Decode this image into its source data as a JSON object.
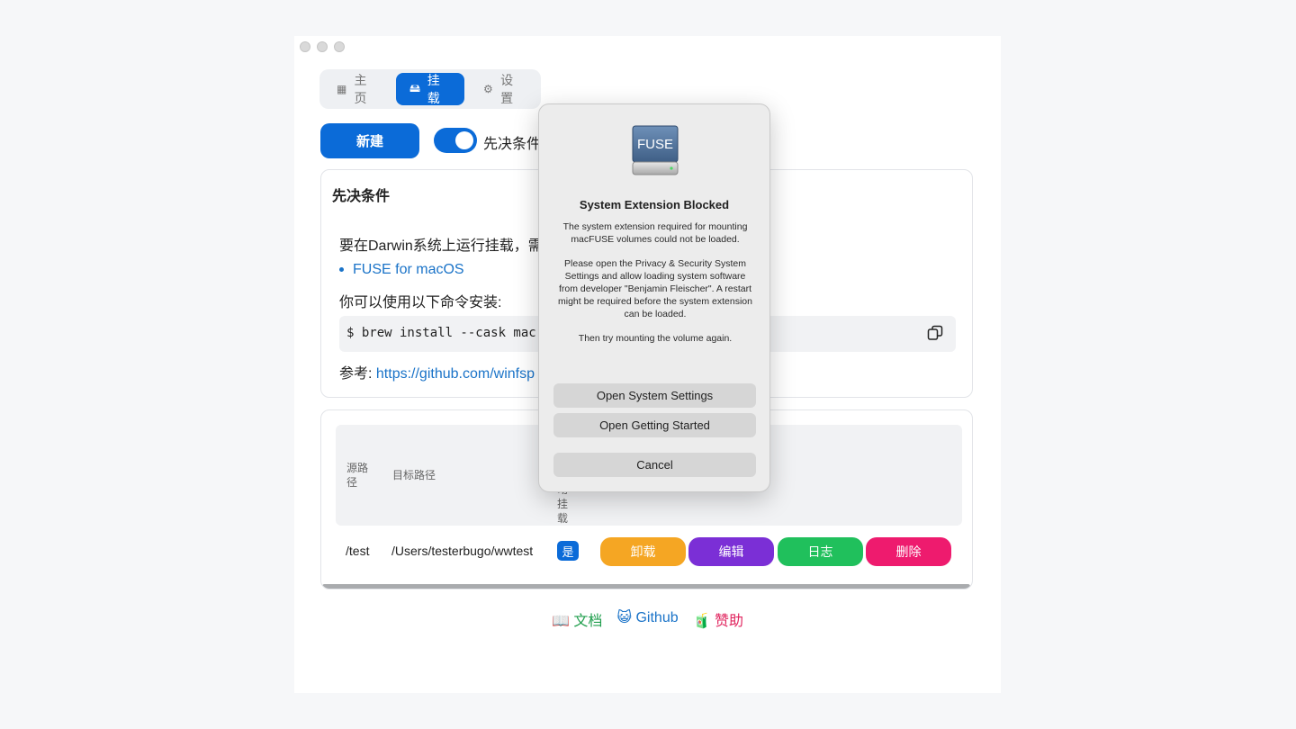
{
  "tabs": [
    {
      "label": "主页",
      "icon": "grid-icon"
    },
    {
      "label": "挂载",
      "icon": "drive-icon"
    },
    {
      "label": "设置",
      "icon": "gear-icon"
    }
  ],
  "toolbar": {
    "new_label": "新建",
    "toggle_label": "先决条件",
    "toggle_on": true
  },
  "prereq": {
    "title": "先决条件",
    "line1": "要在Darwin系统上运行挂载，需",
    "link_item": "FUSE for macOS",
    "line2": "你可以使用以下命令安装:",
    "command": "$ brew install --cask mac",
    "ref_label": "参考: ",
    "ref_link": "https://github.com/winfsp"
  },
  "table": {
    "headers": [
      "源路径",
      "目标路径",
      "自动挂载"
    ],
    "headers_visible": {
      "col1": "源路\n径",
      "col2": "目标路径",
      "col3": "动\n挂\n载"
    },
    "rows": [
      {
        "source": "/test",
        "target": "/Users/testerbugo/wwtest",
        "auto": "是",
        "actions": [
          "卸载",
          "编辑",
          "日志",
          "删除"
        ]
      }
    ]
  },
  "footer": {
    "docs": "📖 文档",
    "github": "😺 Github",
    "sponsor": "🧃 赞助"
  },
  "dialog": {
    "icon_text": "FUSE",
    "title": "System Extension Blocked",
    "msg1": "The system extension required for mounting macFUSE volumes could not be loaded.",
    "msg2": "Please open the Privacy & Security System Settings and allow loading system software from developer \"Benjamin Fleischer\". A restart might be required before the system extension can be loaded.",
    "msg3": "Then try mounting the volume again.",
    "btn_settings": "Open System Settings",
    "btn_started": "Open Getting Started",
    "btn_cancel": "Cancel"
  },
  "colors": {
    "accent": "#0b6bd8",
    "unmount": "#f5a623",
    "edit": "#7b2fd6",
    "log": "#20c05c",
    "delete": "#ee1b6e"
  }
}
